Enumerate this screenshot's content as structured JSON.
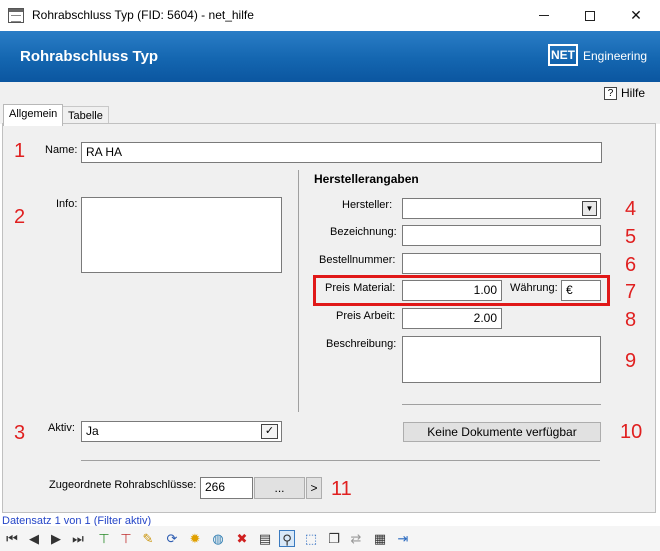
{
  "window": {
    "title": "Rohrabschluss Typ (FID: 5604) - net_hilfe",
    "minimize_glyph": "",
    "maximize_glyph": "",
    "close_glyph": "✕"
  },
  "header": {
    "title": "Rohrabschluss Typ",
    "logo_box": "NET",
    "logo_text": "Engineering"
  },
  "helpbar": {
    "help_icon": "?",
    "help_label": "Hilfe"
  },
  "tabs": [
    {
      "label": "Allgemein",
      "active": true
    },
    {
      "label": "Tabelle",
      "active": false
    }
  ],
  "form": {
    "name_label": "Name:",
    "name_value": "RA HA",
    "info_label": "Info:",
    "info_value": "",
    "aktiv_label": "Aktiv:",
    "aktiv_value": "Ja",
    "aktiv_check": "✓",
    "hersteller_section": "Herstellerangaben",
    "hersteller_label": "Hersteller:",
    "hersteller_value": "",
    "hersteller_dropdown": "▼",
    "bezeichnung_label": "Bezeichnung:",
    "bezeichnung_value": "",
    "bestellnummer_label": "Bestellnummer:",
    "bestellnummer_value": "",
    "preis_material_label": "Preis Material:",
    "preis_material_value": "1.00",
    "waehrung_label": "Währung:",
    "waehrung_value": "€",
    "preis_arbeit_label": "Preis Arbeit:",
    "preis_arbeit_value": "2.00",
    "beschreibung_label": "Beschreibung:",
    "beschreibung_value": "",
    "dokumente_button": "Keine Dokumente verfügbar",
    "zugeordnete_label": "Zugeordnete Rohrabschlüsse:",
    "zugeordnete_value": "266",
    "zugeordnete_dots": "...",
    "zugeordnete_arrow": ">"
  },
  "annotations": [
    "1",
    "2",
    "3",
    "4",
    "5",
    "6",
    "7",
    "8",
    "9",
    "10",
    "11"
  ],
  "annotation_color": "#e02020",
  "status": {
    "text": "Datensatz 1 von 1 (Filter aktiv)"
  },
  "navbar": {
    "icons": [
      {
        "name": "first-record-icon",
        "glyph": "⏮"
      },
      {
        "name": "previous-record-icon",
        "glyph": "◀"
      },
      {
        "name": "next-record-icon",
        "glyph": "▶"
      },
      {
        "name": "last-record-icon",
        "glyph": "⏭"
      },
      {
        "name": "filter-add-icon",
        "glyph": "⊤"
      },
      {
        "name": "filter-remove-icon",
        "glyph": "⊤"
      },
      {
        "name": "edit-pencil-icon",
        "glyph": "✎"
      },
      {
        "name": "refresh-icon",
        "glyph": "⟳"
      },
      {
        "name": "new-record-icon",
        "glyph": "✹"
      },
      {
        "name": "globe-icon",
        "glyph": "◍"
      },
      {
        "name": "delete-icon",
        "glyph": "✖"
      },
      {
        "name": "print-icon",
        "glyph": "▤"
      },
      {
        "name": "zoom-icon",
        "glyph": "⚲"
      },
      {
        "name": "select-icon",
        "glyph": "⬚"
      },
      {
        "name": "copy-icon",
        "glyph": "❐"
      },
      {
        "name": "link-icon",
        "glyph": "⇄"
      },
      {
        "name": "table-edit-icon",
        "glyph": "▦"
      },
      {
        "name": "exit-icon",
        "glyph": "⇥"
      }
    ]
  }
}
